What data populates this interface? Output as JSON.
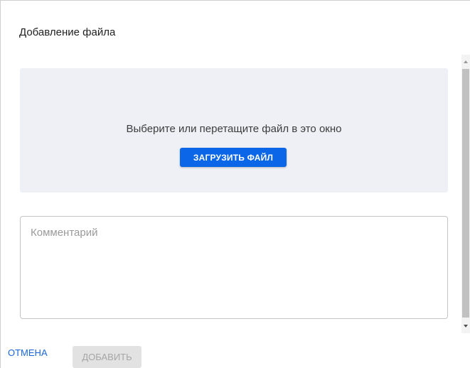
{
  "dialog": {
    "title": "Добавление файла"
  },
  "dropzone": {
    "text": "Выберите или перетащите файл в это окно",
    "upload_label": "ЗАГРУЗИТЬ ФАЙЛ"
  },
  "comment": {
    "placeholder": "Комментарий",
    "value": ""
  },
  "footer": {
    "cancel_label": "ОТМЕНА",
    "add_label": "ДОБАВИТЬ",
    "add_disabled": true
  },
  "colors": {
    "accent": "#0b67e8",
    "link": "#1a66d9",
    "dropzone_bg": "#eef0f5",
    "disabled_bg": "#e2e2e2"
  },
  "icons": {
    "scroll_up": "scroll-up-arrow-icon",
    "scroll_down": "scroll-down-arrow-icon"
  }
}
